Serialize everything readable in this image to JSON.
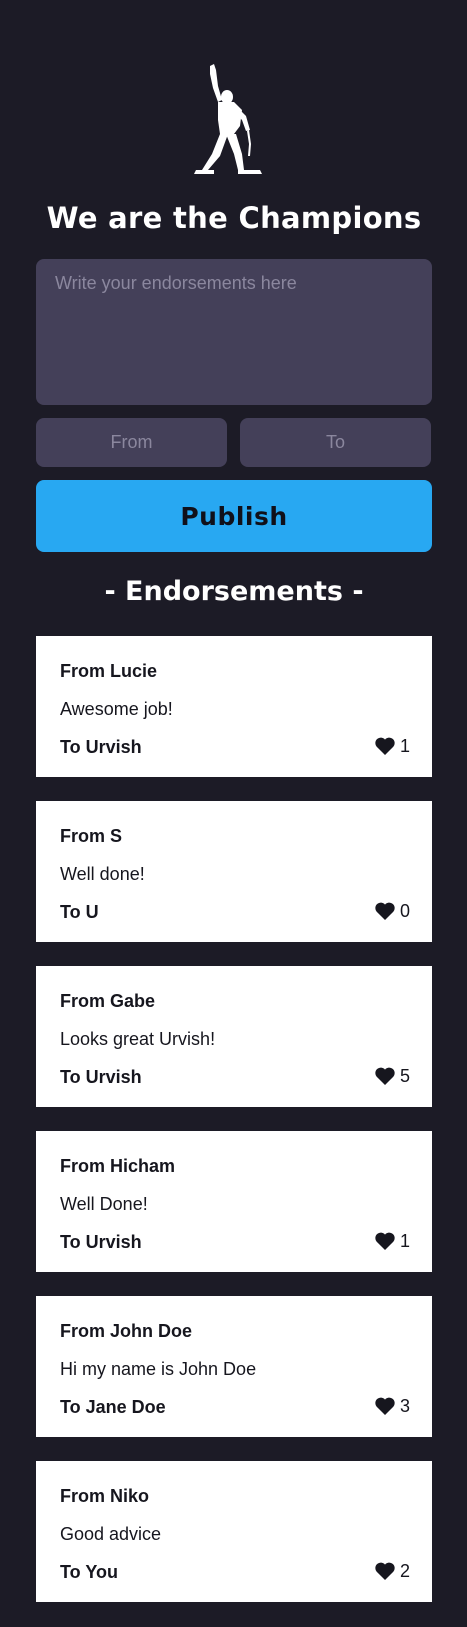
{
  "header": {
    "title": "We are the Champions",
    "logo_icon": "champion-silhouette-icon"
  },
  "form": {
    "endorsement_placeholder": "Write your endorsements here",
    "from_placeholder": "From",
    "to_placeholder": "To",
    "publish_label": "Publish"
  },
  "section": {
    "title": "- Endorsements -"
  },
  "colors": {
    "background": "#1c1b26",
    "input": "#444059",
    "accent": "#28a8f2",
    "card": "#ffffff"
  },
  "endorsements": [
    {
      "from": "From Lucie",
      "message": "Awesome job!",
      "to": "To Urvish",
      "likes": "1"
    },
    {
      "from": "From S",
      "message": "Well done!",
      "to": "To U",
      "likes": "0"
    },
    {
      "from": "From Gabe",
      "message": "Looks great Urvish!",
      "to": "To Urvish",
      "likes": "5"
    },
    {
      "from": "From Hicham",
      "message": "Well Done!",
      "to": "To Urvish",
      "likes": "1"
    },
    {
      "from": "From John Doe",
      "message": "Hi my name is John Doe",
      "to": "To Jane Doe",
      "likes": "3"
    },
    {
      "from": "From Niko",
      "message": "Good advice",
      "to": "To You",
      "likes": "2"
    }
  ]
}
